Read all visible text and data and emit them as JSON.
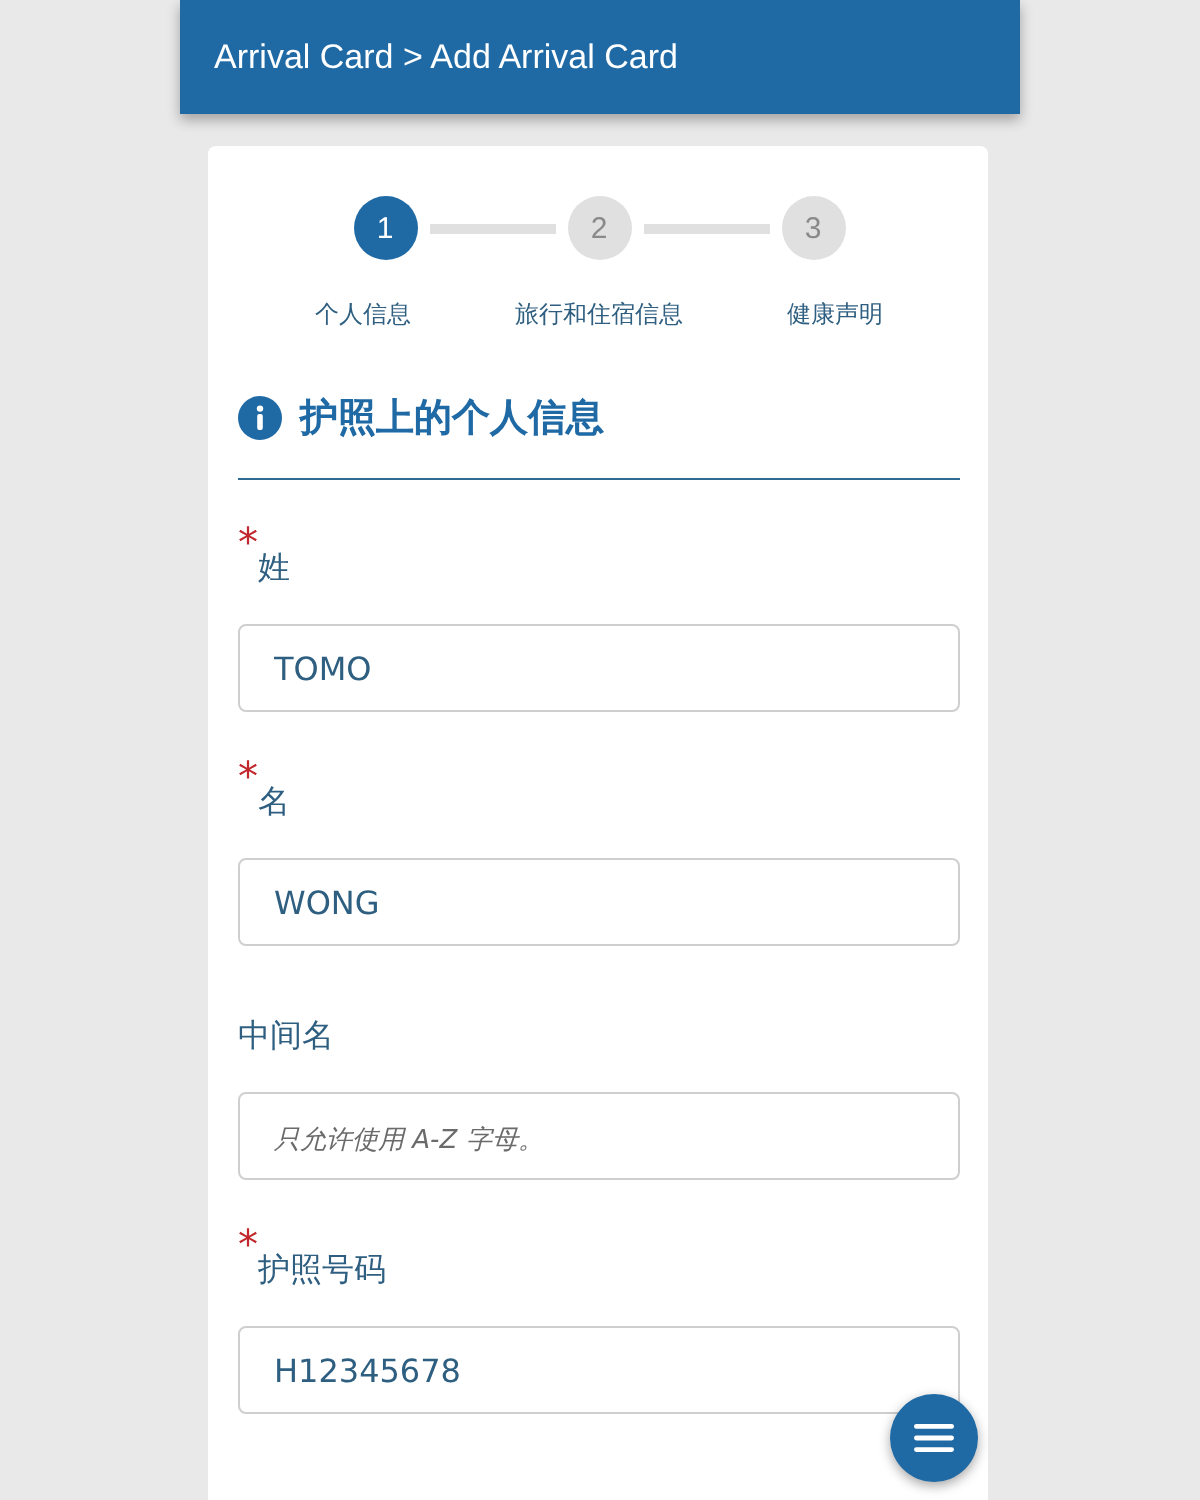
{
  "header": {
    "title": "Arrival Card > Add Arrival Card"
  },
  "steps": [
    {
      "number": "1",
      "label": "个人信息",
      "selected": true
    },
    {
      "number": "2",
      "label": "旅行和住宿信息",
      "selected": false
    },
    {
      "number": "3",
      "label": "健康声明",
      "selected": false
    }
  ],
  "section": {
    "title": "护照上的个人信息"
  },
  "fields": [
    {
      "mark": "*",
      "label": "姓",
      "value": "TOMO"
    },
    {
      "mark": "*",
      "label": "名",
      "value": "WONG"
    },
    {
      "label": "中间名",
      "placeholder": "只允许使用 A-Z 字母。"
    },
    {
      "mark": "*",
      "label": "护照号码",
      "value": "H12345678"
    }
  ]
}
